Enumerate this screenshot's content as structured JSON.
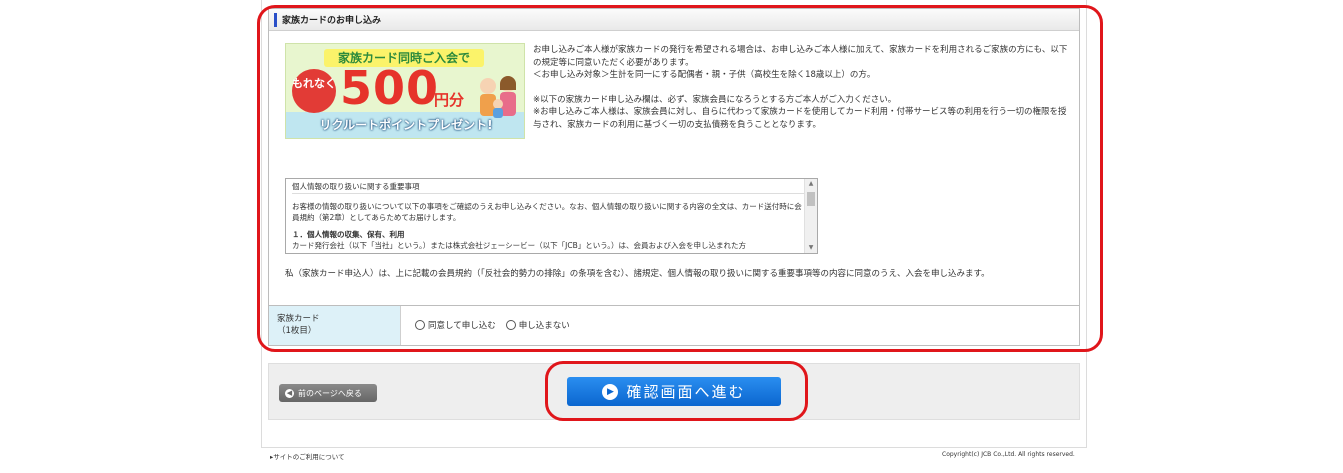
{
  "section": {
    "title": "家族カードのお申し込み",
    "banner": {
      "top_text": "家族カード同時ご入会で",
      "badge_text": "もれなく",
      "amount": "500",
      "unit": "円分",
      "bottom_text": "リクルートポイントプレゼント!"
    },
    "intro": [
      "お申し込みご本人様が家族カードの発行を希望される場合は、お申し込みご本人様に加えて、家族カードを利用されるご家族の方にも、以下の規定等に同意いただく必要があります。",
      "＜お申し込み対象＞生計を同一にする配偶者・親・子供（高校生を除く18歳以上）の方。",
      "※以下の家族カード申し込み欄は、必ず、家族会員になろうとする方ご本人がご入力ください。",
      "※お申し込みご本人様は、家族会員に対し、自らに代わって家族カードを使用してカード利用・付帯サービス等の利用を行う一切の権限を授与され、家族カードの利用に基づく一切の支払債務を負うこととなります。"
    ],
    "terms_box": {
      "heading": "個人情報の取り扱いに関する重要事項",
      "paragraph": "お客様の情報の取り扱いについて以下の事項をご確認のうえお申し込みください。なお、個人情報の取り扱いに関する内容の全文は、カード送付時に会員規約（第2章）としてあらためてお届けします。",
      "item_title": "１．個人情報の収集、保有、利用",
      "item_text": "カード発行会社（以下「当社」という。）または株式会社ジェーシービー（以下「JCB」という。）は、会員および入会を申し込まれた方"
    },
    "agreement": "私（家族カード申込人）は、上に記載の会員規約（「反社会的勢力の排除」の条項を含む）、諸規定、個人情報の取り扱いに関する重要事項等の内容に同意のうえ、入会を申し込みます。",
    "form_row": {
      "label_line1": "家族カード",
      "label_line2": "（1枚目）",
      "options": [
        "同意して申し込む",
        "申し込まない"
      ]
    }
  },
  "buttons": {
    "back": "前のページへ戻る",
    "confirm": "確認画面へ進む"
  },
  "footer": {
    "link": "サイトのご利用について",
    "copyright": "Copyright(c) JCB Co.,Ltd. All rights reserved."
  },
  "colors": {
    "annotation_red": "#e0161b",
    "confirm_blue": "#0b66cf",
    "label_bg": "#ddf1f8"
  }
}
